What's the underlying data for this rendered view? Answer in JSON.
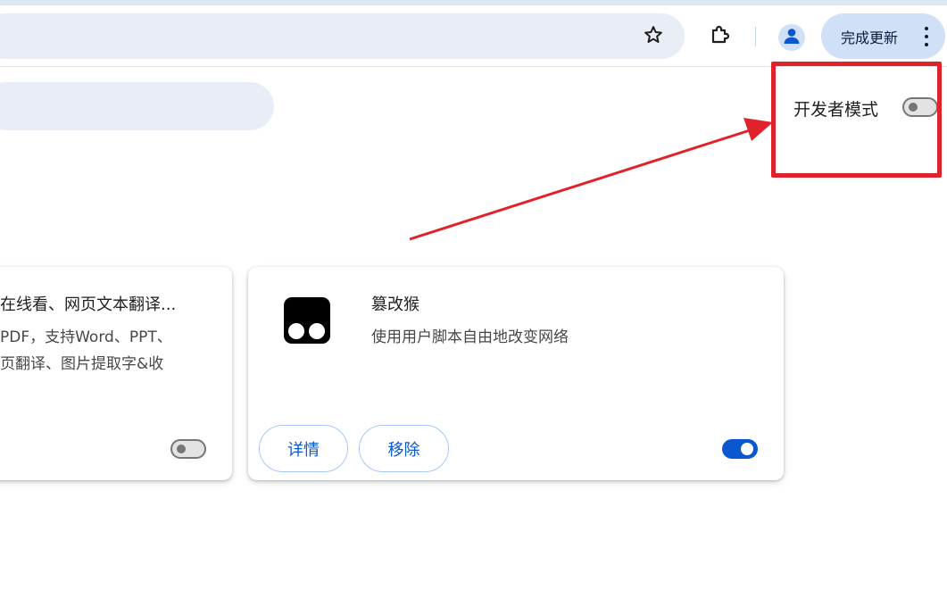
{
  "toolbar": {
    "update_label": "完成更新"
  },
  "header": {
    "dev_mode_label": "开发者模式",
    "dev_mode_enabled": false
  },
  "extensions": [
    {
      "title": "在线看、网页文本翻译...",
      "desc_lines": [
        "PDF，支持Word、PPT、",
        "页翻译、图片提取字&收"
      ],
      "enabled": false
    },
    {
      "title": "篡改猴",
      "description": "使用用户脚本自由地改变网络",
      "details_label": "详情",
      "remove_label": "移除",
      "enabled": true,
      "icon": "tampermonkey-icon"
    }
  ],
  "icons": {
    "bookmark": "star-icon",
    "extensions": "puzzle-icon",
    "profile": "person-icon",
    "menu": "more-vert-icon"
  },
  "colors": {
    "accent": "#0b57d0",
    "annotation": "#e0232b",
    "toggle_off": "#747775"
  }
}
